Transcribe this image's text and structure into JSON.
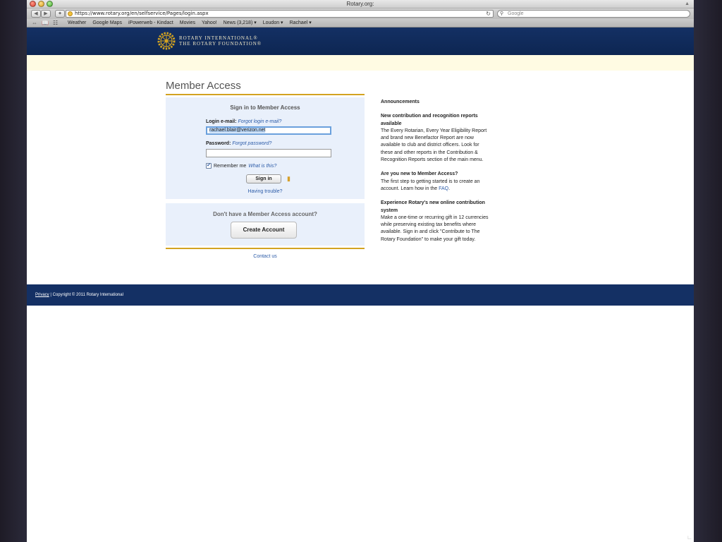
{
  "window": {
    "title": "Rotary.org:"
  },
  "browser": {
    "url": "https://www.rotary.org/en/selfservice/Pages/login.aspx",
    "search_placeholder": "Google",
    "bookmarks": [
      "Weather",
      "Google Maps",
      "iPowerweb - Kindact",
      "Movies",
      "Yahoo!",
      "News (3,218) ▾",
      "Loudon ▾",
      "Rachael ▾"
    ]
  },
  "header": {
    "logo_line1": "ROTARY INTERNATIONAL®",
    "logo_line2": "THE ROTARY FOUNDATION®"
  },
  "main": {
    "title": "Member Access",
    "signin_heading": "Sign in to Member Access",
    "email_label": "Login e-mail:",
    "forgot_email": "Forgot login e-mail?",
    "email_value": "rachael.blair@verizon.net",
    "password_label": "Password:",
    "forgot_password": "Forgot password?",
    "remember_label": "Remember me",
    "what_is_this": "What is this?",
    "remember_checked": true,
    "signin_button": "Sign in",
    "having_trouble": "Having trouble?",
    "no_account": "Don't have a Member Access account?",
    "create_button": "Create Account",
    "contact": "Contact us"
  },
  "announcements": {
    "heading": "Announcements",
    "items": [
      {
        "title": "New contribution and recognition reports available",
        "body": "The Every Rotarian, Every Year Eligibility Report and brand new Benefactor Report are now available to club and district officers. Look for these and other reports in the Contribution & Recognition Reports section of the main menu."
      },
      {
        "title": "Are you new to Member Access?",
        "body": "The first step to getting started is to create an account. Learn how in the ",
        "link": "FAQ",
        "tail": "."
      },
      {
        "title": "Experience Rotary's new online contribution system",
        "body": "Make a one-time or recurring gift in 12 currencies while preserving existing tax benefits where available. Sign in and click \"Contribute to The Rotary Foundation\" to make your gift today."
      }
    ]
  },
  "footer": {
    "privacy": "Privacy",
    "copyright": " | Copyright © 2011 Rotary International"
  },
  "colors": {
    "header_blue": "#143064",
    "gold": "#d3a321",
    "link": "#2d5ca8",
    "panel": "#e9f0fb"
  }
}
